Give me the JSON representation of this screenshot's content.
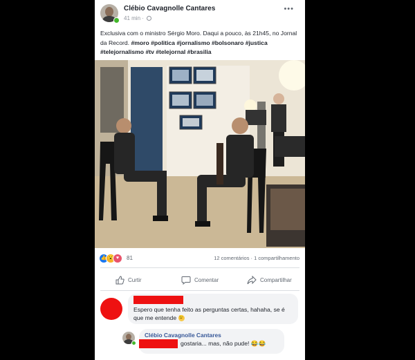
{
  "post": {
    "author": "Clébio Cavagnolle Cantares",
    "time": "41 min",
    "separator": "·",
    "more_icon": "•••",
    "text_intro": "Exclusiva com o ministro Sérgio Moro. Daqui a pouco, às 21h45, no Jornal da Record.",
    "hashtags": [
      "#moro",
      "#politica",
      "#jornalismo",
      "#bolsonaro",
      "#justica",
      "#telejornalismo",
      "#tv",
      "#telejornal",
      "#brasilia"
    ]
  },
  "reactions": {
    "icons": [
      "like-reaction-icon",
      "wow-reaction-icon",
      "love-reaction-icon"
    ],
    "count": "81"
  },
  "stats": {
    "text": "12 comentários · 1 compartilhamento"
  },
  "actions": {
    "like": "Curtir",
    "comment": "Comentar",
    "share": "Compartilhar"
  },
  "comments": [
    {
      "text": "Espero que tenha feito as perguntas certas, hahaha, se é que me entende",
      "emoji": "😉"
    }
  ],
  "reply": {
    "author": "Clébio Cavagnolle Cantares",
    "text": "gostaria... mas, não pude!",
    "emoji": "😂😂"
  },
  "colors": {
    "background": "#000000",
    "card": "#ffffff",
    "redaction": "#ee1111",
    "bubble": "#f2f3f5",
    "text": "#1d2129",
    "muted": "#606770"
  }
}
